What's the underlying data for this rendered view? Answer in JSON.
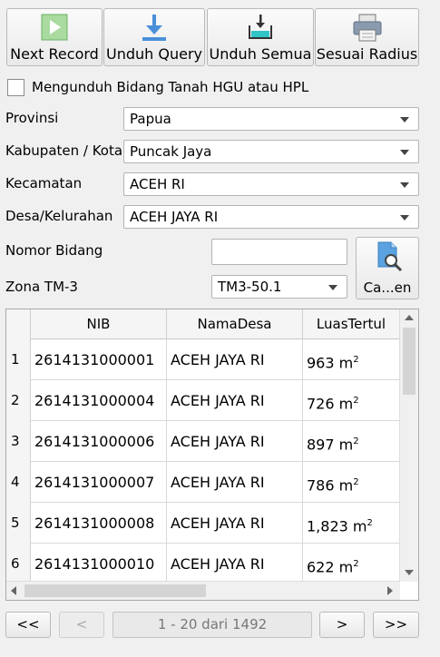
{
  "toolbar": {
    "next_record": "Next Record",
    "download_query": "Unduh Query",
    "download_all": "Unduh Semua",
    "fit_radius": "Sesuai Radius"
  },
  "options": {
    "download_hgu_hpl_label": "Mengunduh Bidang Tanah HGU atau HPL",
    "download_hgu_hpl_checked": false
  },
  "form": {
    "province_label": "Provinsi",
    "province_value": "Papua",
    "regency_label": "Kabupaten / Kota",
    "regency_value": "Puncak Jaya",
    "district_label": "Kecamatan",
    "district_value": "ACEH RI",
    "village_label": "Desa/Kelurahan",
    "village_value": "ACEH JAYA RI",
    "parcel_number_label": "Nomor Bidang",
    "parcel_number_value": "",
    "zone_label": "Zona TM-3",
    "zone_value": "TM3-50.1",
    "search_button": "Ca...en"
  },
  "table": {
    "columns": [
      "NIB",
      "NamaDesa",
      "LuasTertul"
    ],
    "rows": [
      {
        "num": "1",
        "nib": "2614131000001",
        "desa": "ACEH JAYA RI",
        "luas": "963 m",
        "unit_sup": "2"
      },
      {
        "num": "2",
        "nib": "2614131000004",
        "desa": "ACEH JAYA RI",
        "luas": "726 m",
        "unit_sup": "2"
      },
      {
        "num": "3",
        "nib": "2614131000006",
        "desa": "ACEH JAYA RI",
        "luas": "897 m",
        "unit_sup": "2"
      },
      {
        "num": "4",
        "nib": "2614131000007",
        "desa": "ACEH JAYA RI",
        "luas": "786 m",
        "unit_sup": "2"
      },
      {
        "num": "5",
        "nib": "2614131000008",
        "desa": "ACEH JAYA RI",
        "luas": "1,823 m",
        "unit_sup": "2"
      },
      {
        "num": "6",
        "nib": "2614131000010",
        "desa": "ACEH JAYA RI",
        "luas": "622 m",
        "unit_sup": "2"
      }
    ]
  },
  "pagination": {
    "first": "<<",
    "prev": "<",
    "info": "1 - 20 dari 1492",
    "next": ">",
    "last": ">>"
  }
}
